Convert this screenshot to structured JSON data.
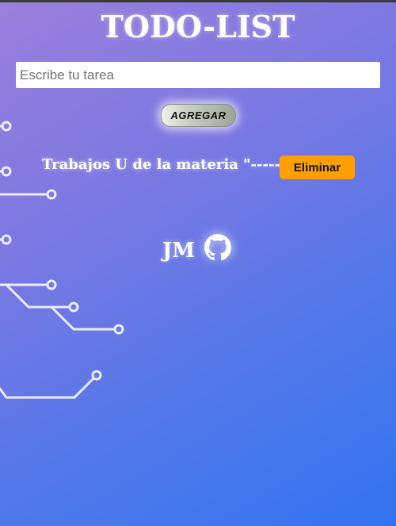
{
  "app": {
    "title": "TODO-LIST"
  },
  "form": {
    "input_placeholder": "Escribe tu tarea",
    "input_value": "",
    "add_label": "AGREGAR"
  },
  "tasks": [
    {
      "text": "Trabajos U de la materia \"------\"",
      "delete_label": "Eliminar"
    }
  ],
  "footer": {
    "initials": "JM",
    "link_icon": "github-icon"
  },
  "colors": {
    "background_start": "#9b7fdc",
    "background_end": "#3373ef",
    "delete_button": "#ffa000",
    "text": "#ffffff"
  }
}
